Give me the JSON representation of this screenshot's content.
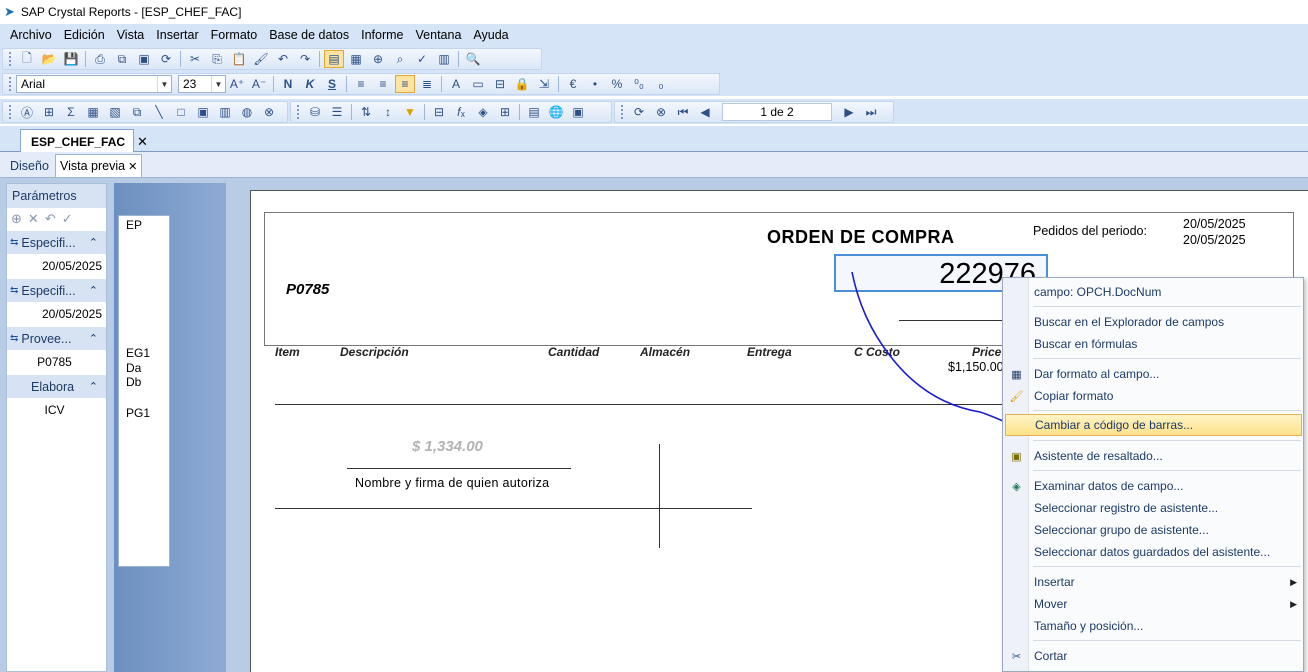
{
  "window": {
    "title": "SAP Crystal Reports - [ESP_CHEF_FAC]"
  },
  "menubar": [
    "Archivo",
    "Edición",
    "Vista",
    "Insertar",
    "Formato",
    "Base de datos",
    "Informe",
    "Ventana",
    "Ayuda"
  ],
  "format_toolbar": {
    "font": "Arial",
    "size": "23",
    "bold": "N",
    "italic": "K",
    "underline": "S",
    "currency": "€",
    "percent": "%"
  },
  "nav_toolbar": {
    "page_indicator": "1 de 2"
  },
  "doc_tab": {
    "label": "ESP_CHEF_FAC",
    "close": "✕"
  },
  "view_tabs": {
    "design": "Diseño",
    "preview": "Vista previa",
    "close": "✕"
  },
  "parameters": {
    "title": "Parámetros",
    "groups": [
      {
        "label": "Especifi...",
        "value": "20/05/2025"
      },
      {
        "label": "Especifi...",
        "value": "20/05/2025"
      },
      {
        "label": "Provee...",
        "value": "P0785"
      },
      {
        "label": "Elabora",
        "value": "ICV"
      }
    ]
  },
  "tree": {
    "items": [
      "EP",
      "EG1",
      "Da",
      "Db",
      "PG1"
    ]
  },
  "report": {
    "title": "ORDEN DE COMPRA",
    "period_label": "Pedidos del periodo:",
    "period_from": "20/05/2025",
    "period_to": "20/05/2025",
    "doc_num": "222976",
    "vendor_code": "P0785",
    "columns": [
      "Item",
      "Descripción",
      "Cantidad",
      "Almacén",
      "Entrega",
      "C Costo",
      "Price"
    ],
    "price_value": "$1,150.00",
    "total": "$ 1,334.00",
    "signature_label": "Nombre y firma de quien autoriza"
  },
  "context_menu": {
    "items": [
      {
        "label": "campo: OPCH.DocNum"
      },
      {
        "label": "Buscar en el Explorador de campos"
      },
      {
        "label": "Buscar en fórmulas"
      },
      {
        "label": "Dar formato al campo..."
      },
      {
        "label": "Copiar formato"
      },
      {
        "label": "Cambiar a código de barras..."
      },
      {
        "label": "Asistente de resaltado..."
      },
      {
        "label": "Examinar datos de campo..."
      },
      {
        "label": "Seleccionar registro de asistente..."
      },
      {
        "label": "Seleccionar grupo de asistente..."
      },
      {
        "label": "Seleccionar datos guardados del asistente..."
      },
      {
        "label": "Insertar"
      },
      {
        "label": "Mover"
      },
      {
        "label": "Tamaño y posición..."
      },
      {
        "label": "Cortar"
      }
    ]
  },
  "colors": {
    "toolbar_bg": "#d5e4f6",
    "highlight": "#fde28a",
    "annotation_stroke": "#1a1ad6",
    "selection_box": "#4a90d9"
  }
}
